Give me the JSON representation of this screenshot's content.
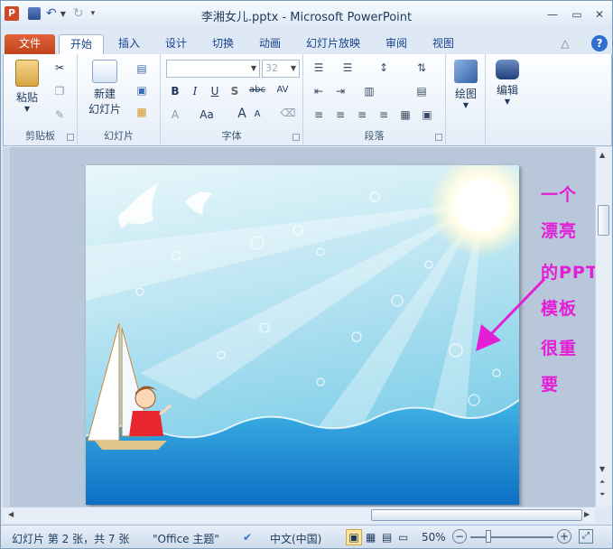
{
  "window": {
    "title": "李湘女儿.pptx - Microsoft PowerPoint",
    "app_icon_letter": "P"
  },
  "tabs": {
    "file": "文件",
    "items": [
      "开始",
      "插入",
      "设计",
      "切换",
      "动画",
      "幻灯片放映",
      "审阅",
      "视图"
    ],
    "active": "开始"
  },
  "ribbon": {
    "clipboard": {
      "paste": "粘贴",
      "group": "剪贴板"
    },
    "slides": {
      "new_slide": "新建",
      "new_slide_2": "幻灯片",
      "group": "幻灯片"
    },
    "font": {
      "size": "32",
      "group": "字体",
      "bold": "B",
      "italic": "I",
      "underline": "U",
      "shadow": "S",
      "strike": "abc",
      "spacing": "AV",
      "case": "Aa",
      "grow": "A",
      "shrink": "A",
      "color": "A"
    },
    "paragraph": {
      "group": "段落"
    },
    "drawing": {
      "label": "绘图"
    },
    "editing": {
      "label": "编辑"
    }
  },
  "slide_annotation": [
    "一个",
    "漂亮",
    "的PPT",
    "模板",
    "很重",
    "要"
  ],
  "annotation_color": "#e41ed7",
  "status": {
    "slide_info": "幻灯片 第 2 张，共 7 张",
    "theme": "\"Office 主题\"",
    "language": "中文(中国)",
    "zoom": "50%",
    "zoom_minus": "−",
    "zoom_plus": "+"
  }
}
